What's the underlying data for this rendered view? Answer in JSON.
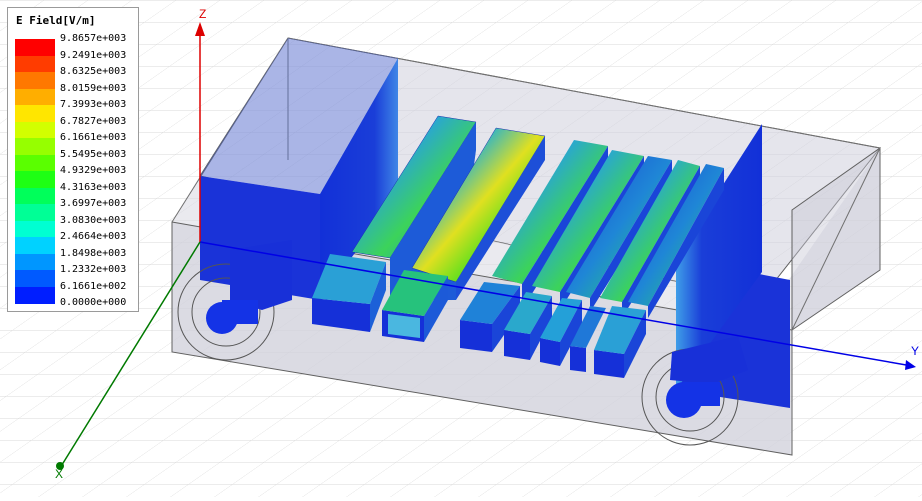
{
  "legend": {
    "title": "E Field[V/m]",
    "colors": [
      "#ff0000",
      "#ff3c00",
      "#ff7800",
      "#ffae00",
      "#ffe600",
      "#d2ff00",
      "#96ff00",
      "#5aff00",
      "#1eff14",
      "#00ff5a",
      "#00ff96",
      "#00ffd2",
      "#00d2ff",
      "#0096ff",
      "#005aff",
      "#001eff"
    ],
    "values": [
      "9.8657e+003",
      "9.2491e+003",
      "8.6325e+003",
      "8.0159e+003",
      "7.3993e+003",
      "6.7827e+003",
      "6.1661e+003",
      "5.5495e+003",
      "4.9329e+003",
      "4.3163e+003",
      "3.6997e+003",
      "3.0830e+003",
      "2.4664e+003",
      "1.8498e+003",
      "1.2332e+003",
      "6.1661e+002",
      "0.0000e+000"
    ]
  },
  "axes": {
    "z": "Z",
    "y": "Y",
    "x": "X"
  },
  "colors": {
    "axis_z": "#dd0000",
    "axis_y": "#0000e6",
    "axis_x": "#007a00",
    "field_low": "#1a2fd6",
    "field_high": "#55e31b"
  }
}
